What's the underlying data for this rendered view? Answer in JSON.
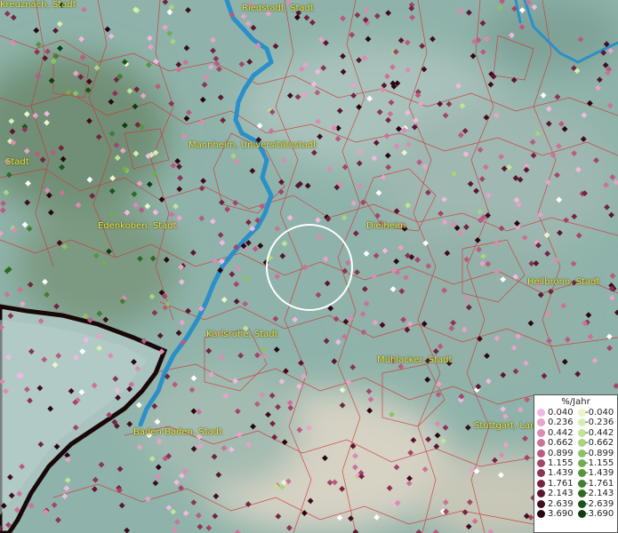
{
  "cities": [
    {
      "id": "kreuznach",
      "label": "Kreuznach, Stadt"
    },
    {
      "id": "riedstadt",
      "label": "Riedstadt, Stadt"
    },
    {
      "id": "mannheim",
      "label": "Mannheim, Universitätsstadt"
    },
    {
      "id": "stadt-west",
      "label": "Stadt"
    },
    {
      "id": "edenkoben",
      "label": "Edenkoben, Stadt"
    },
    {
      "id": "dielheim",
      "label": "Dielheim"
    },
    {
      "id": "heilbronn",
      "label": "Heilbronn, Stadt"
    },
    {
      "id": "karlsruhe",
      "label": "Karlsruhe, Stadt"
    },
    {
      "id": "muehlacker",
      "label": "Mühlacker, Stadt"
    },
    {
      "id": "stuttgart",
      "label": "Stuttgart, Land"
    },
    {
      "id": "baden-baden",
      "label": "Baden-Baden, Stadt"
    }
  ],
  "legend": {
    "title": "%/Jahr",
    "positive": [
      "0.040",
      "0.236",
      "0.442",
      "0.662",
      "0.899",
      "1.155",
      "1.439",
      "1.761",
      "2.143",
      "2.639",
      "3.690"
    ],
    "negative": [
      "-0.040",
      "-0.236",
      "-0.442",
      "-0.662",
      "-0.899",
      "-1.155",
      "-1.439",
      "-1.761",
      "-2.143",
      "-2.639",
      "-3.690"
    ],
    "positive_colors": [
      "#f2b8e0",
      "#e9a2c8",
      "#dc8bb4",
      "#cc7298",
      "#ba5a82",
      "#a3456a",
      "#8b3456",
      "#742442",
      "#5c1630",
      "#430c1e",
      "#2a0610"
    ],
    "negative_colors": [
      "#eaf5c8",
      "#d8eeb0",
      "#c2e396",
      "#a8d47c",
      "#8cc264",
      "#70ad4e",
      "#57963c",
      "#40802e",
      "#2c6a22",
      "#1b5418",
      "#0e3d0e"
    ]
  },
  "colors": {
    "river": "#2b8fc9",
    "border": "#d23232",
    "lake": "#a9c4bf",
    "lake_outline": "#1a0808"
  }
}
